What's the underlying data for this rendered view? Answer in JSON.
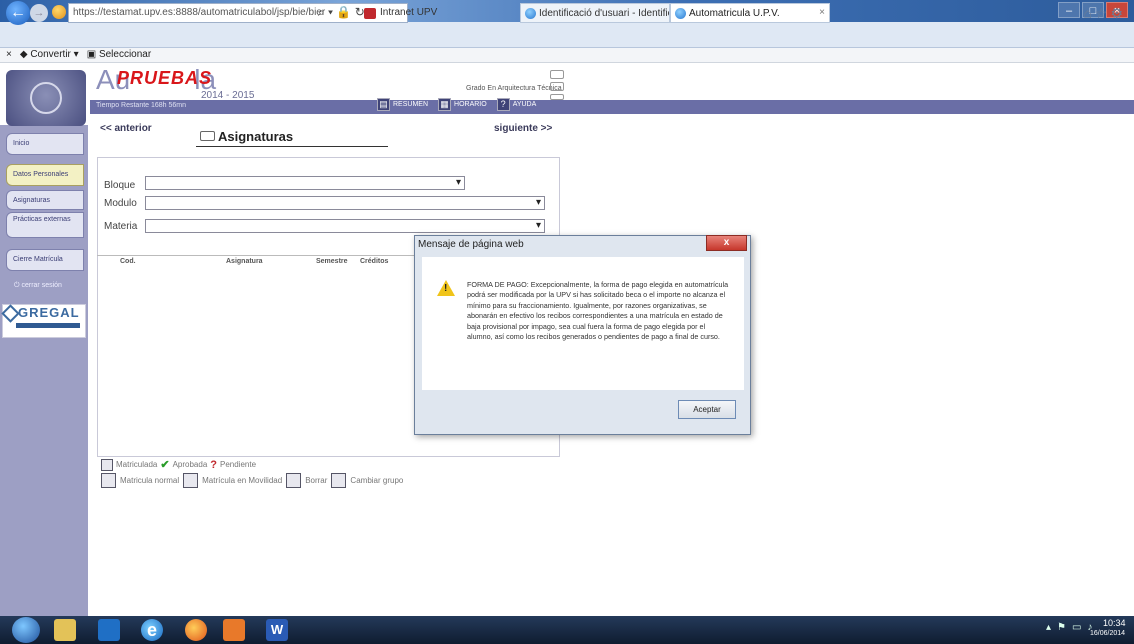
{
  "browser": {
    "url": "https://testamat.upv.es:8888/automatriculabol/jsp/bie/bier",
    "tabs": [
      {
        "label": "Intranet UPV"
      },
      {
        "label": "Identificació d'usuari - Identific..."
      },
      {
        "label": "Automatricula U.P.V."
      }
    ],
    "command_bar": {
      "convert_label": "Convertir",
      "select_label": "Seleccionar",
      "close_glyph": "×"
    }
  },
  "header": {
    "app_title_prefix": "Au",
    "app_title_suffix": "la",
    "watermark": "PRUEBAS",
    "year": "2014 - 2015",
    "degree": "Grado En Arquitectura Técnica",
    "time_remaining": "Tiempo Restante 168h 56mn",
    "toolbar": [
      {
        "label": "RESUMEN",
        "icon": "summary-icon"
      },
      {
        "label": "HORARIO",
        "icon": "schedule-icon"
      },
      {
        "label": "AYUDA",
        "icon": "help-icon"
      }
    ]
  },
  "sidebar": {
    "items": [
      {
        "label": "Inicio"
      },
      {
        "label": "Datos Personales",
        "active": true
      },
      {
        "label": "Asignaturas"
      },
      {
        "label": "Prácticas externas"
      },
      {
        "label": "Cierre Matrícula"
      }
    ],
    "logout": "cerrar sesión",
    "partner": "GREGAL"
  },
  "main": {
    "prev_label": "<< anterior",
    "next_label": "siguiente >>",
    "section_title": "Asignaturas",
    "filters": [
      {
        "label": "Bloque",
        "value": ""
      },
      {
        "label": "Modulo",
        "value": ""
      },
      {
        "label": "Materia",
        "value": ""
      }
    ],
    "columns": [
      "Cod.",
      "Asignatura",
      "Semestre",
      "Créditos"
    ],
    "legend1": [
      "Matriculada",
      "Aprobada",
      "Pendiente"
    ],
    "legend2": [
      "Matricula normal",
      "Matrícula en Movilidad",
      "Borrar",
      "Cambiar grupo"
    ]
  },
  "dialog": {
    "title": "Mensaje de página web",
    "message": "FORMA DE PAGO: Excepcionalmente, la forma de pago elegida en automatrícula podrá ser modificada por la UPV si has solicitado beca o el importe no alcanza el mínimo para su fraccionamiento. Igualmente, por razones organizativas, se abonarán en efectivo los recibos correspondientes a una matrícula en estado de baja provisional por impago, sea cual fuera la forma de pago elegida por el alumno, así como los recibos generados o pendientes de pago a final de curso.",
    "ok_label": "Aceptar",
    "close_label": "x"
  },
  "taskbar": {
    "time": "10:34",
    "date": "16/06/2014"
  }
}
